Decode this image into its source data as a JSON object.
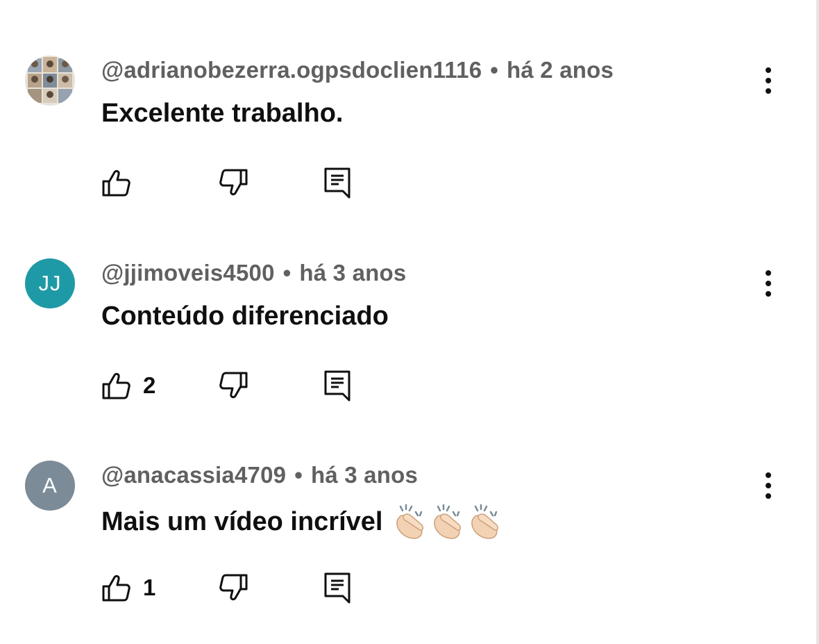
{
  "comments": [
    {
      "author": "@adrianobezerra.ogpsdoclien1116",
      "time": "há 2 anos",
      "text": "Excelente trabalho.",
      "avatar_type": "photo-collage",
      "likes": ""
    },
    {
      "author": "@jjimoveis4500",
      "time": "há 3 anos",
      "text": "Conteúdo diferenciado",
      "avatar_initials": "JJ",
      "avatar_color": "#1e9aa6",
      "likes": "2"
    },
    {
      "author": "@anacassia4709",
      "time": "há 3 anos",
      "text": "Mais um vídeo incrível",
      "avatar_initials": "A",
      "avatar_color": "#7b8b98",
      "likes": "1",
      "emoji": "clapping-hands-icon",
      "emoji_count": 3
    }
  ],
  "separator": "•",
  "icons": {
    "like": "thumbs-up-icon",
    "dislike": "thumbs-down-icon",
    "reply": "comment-reply-icon",
    "menu": "more-vertical-icon"
  },
  "colors": {
    "meta_text": "#606060",
    "text": "#0f0f0f"
  }
}
